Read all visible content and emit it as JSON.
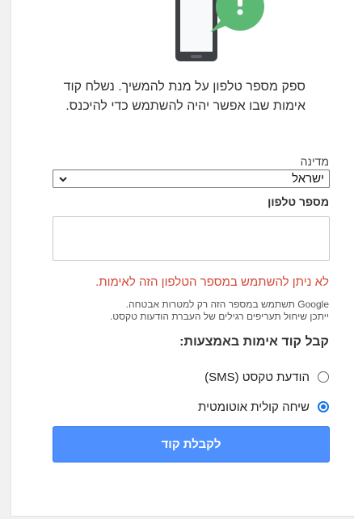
{
  "intro": {
    "text": "ספק מספר טלפון על מנת להמשיך. נשלח קוד אימות שבו אפשר יהיה להשתמש כדי להיכנס."
  },
  "country": {
    "label": "מדינה",
    "selected": "ישראל"
  },
  "phone": {
    "label": "מספר טלפון",
    "value": "",
    "error": "לא ניתן להשתמש במספר הטלפון הזה לאימות."
  },
  "note": {
    "line1": "Google תשתמש במספר הזה רק למטרות אבטחה.",
    "line2": "ייתכן שיחול תעריפים רגילים של העברת הודעות טקסט."
  },
  "method": {
    "title": "קבל קוד אימות באמצעות:",
    "options": [
      {
        "label": "הודעת טקסט (SMS)",
        "checked": false
      },
      {
        "label": "שיחה קולית אוטומטית",
        "checked": true
      }
    ]
  },
  "submit": {
    "label": "לקבלת קוד"
  },
  "colors": {
    "accent": "#4d90fe",
    "radio_checked": "#1a73e8",
    "error": "#d14836",
    "bubble": "#5bb974",
    "phone_body": "#3c4043"
  },
  "icons": {
    "illustration": "phone-with-message-bubble-icon",
    "dropdown": "chevron-down-icon"
  }
}
